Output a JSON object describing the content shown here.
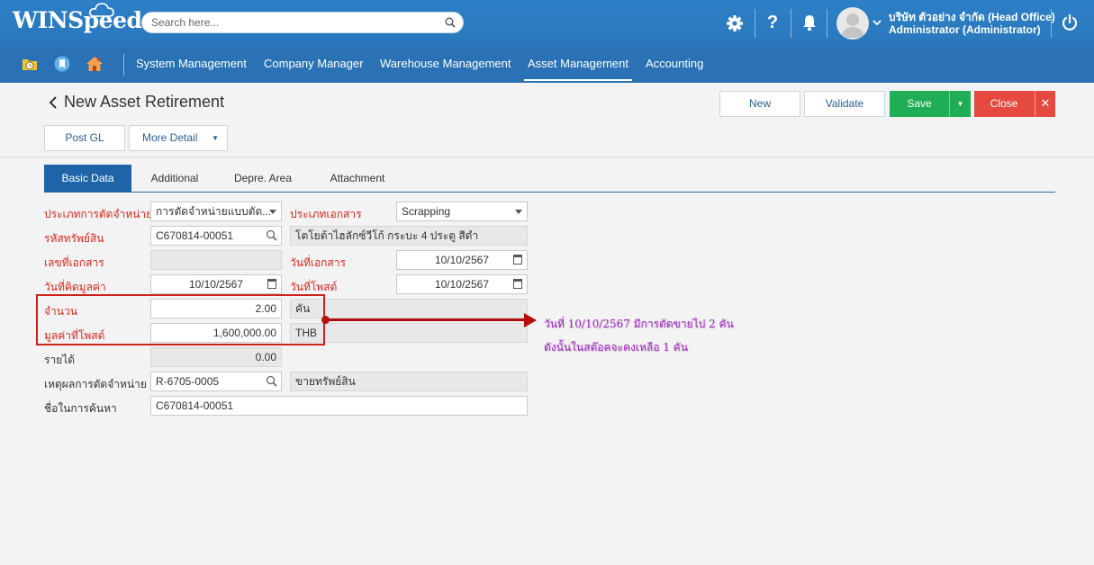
{
  "header": {
    "logo_text": "WINSpeed",
    "search_placeholder": "Search here...",
    "company_line": "บริษัท ตัวอย่าง จำกัด (Head Office)",
    "user_line": "Administrator (Administrator)",
    "icons": [
      "gear-icon",
      "help-icon",
      "bell-icon",
      "avatar",
      "chevron-down-icon",
      "power-icon"
    ]
  },
  "menu": {
    "shortcut_icons": [
      "folder-clock-icon",
      "bookmark-icon",
      "home-icon"
    ],
    "items": [
      "System Management",
      "Company Manager",
      "Warehouse Management",
      "Asset Management",
      "Accounting"
    ],
    "active": "Asset Management"
  },
  "page": {
    "title": "New Asset Retirement",
    "back_icon": "‹"
  },
  "actions": {
    "new": "New",
    "validate": "Validate",
    "save": "Save",
    "close": "Close",
    "post_gl": "Post GL",
    "more_detail": "More Detail"
  },
  "tabs": [
    "Basic Data",
    "Additional",
    "Depre. Area",
    "Attachment"
  ],
  "form": {
    "retire_type_label": "ประเภทการตัดจำหน่าย",
    "retire_type_value": "การตัดจำหน่ายแบบตัด...",
    "doc_type_label": "ประเภทเอกสาร",
    "doc_type_value": "Scrapping",
    "asset_code_label": "รหัสทรัพย์สิน",
    "asset_code_value": "C670814-00051",
    "asset_name_value": "โตโยต้าไฮลักซ์วีโก้ กระบะ 4 ประตู สีดำ",
    "doc_no_label": "เลขที่เอกสาร",
    "doc_no_value": "",
    "doc_date_label": "วันที่เอกสาร",
    "doc_date_value": "10/10/2567",
    "value_date_label": "วันที่คิดมูลค่า",
    "value_date_value": "10/10/2567",
    "post_date_label": "วันที่โพสต์",
    "post_date_value": "10/10/2567",
    "qty_label": "จำนวน",
    "qty_value": "2.00",
    "unit_value": "คัน",
    "post_value_label": "มูลค่าที่โพสต์",
    "post_value_value": "1,600,000.00",
    "currency_value": "THB",
    "revenue_label": "รายได้",
    "revenue_value": "0.00",
    "reason_label": "เหตุผลการตัดจำหน่าย",
    "reason_code_value": "R-6705-0005",
    "reason_name_value": "ขายทรัพย์สิน",
    "search_name_label": "ชื่อในการค้นหา",
    "search_name_value": "C670814-00051"
  },
  "annotation": {
    "line1": "วันที่ 10/10/2567 มีการตัดขายไป 2 คัน",
    "line2": "ดังนั้นในสต๊อคจะคงเหลือ 1 คัน"
  },
  "colors": {
    "header_blue": "#2d7fc6",
    "menu_blue": "#2a72b5",
    "save_green": "#1fad55",
    "close_red": "#e5493f",
    "label_red": "#d8281e",
    "annotation_purple": "#a51fc6"
  }
}
